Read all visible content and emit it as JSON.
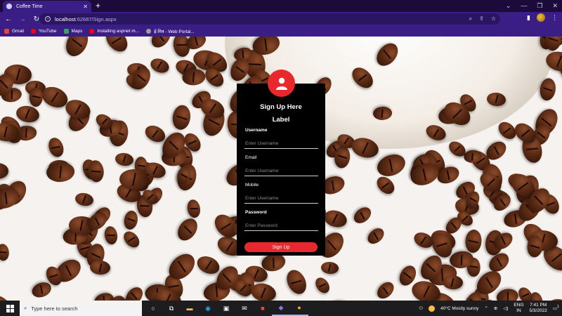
{
  "browser": {
    "tab_title": "Coffee Time",
    "new_tab": "+",
    "url_host": "localhost",
    "url_path": ":62687/Sign.aspx",
    "bookmarks": [
      {
        "label": "Gmail",
        "icon": "gmail-icon",
        "color": "#ea4335"
      },
      {
        "label": "YouTube",
        "icon": "youtube-icon",
        "color": "#ff0000"
      },
      {
        "label": "Maps",
        "icon": "maps-icon",
        "color": "#34a853"
      },
      {
        "label": "Installing aspnet m...",
        "icon": "youtube-icon",
        "color": "#ff0000"
      },
      {
        "label": "ई-मित्र - Web Portal...",
        "icon": "globe-icon",
        "color": "#9e9e9e"
      }
    ]
  },
  "form": {
    "title": "Sign Up Here",
    "label": "Label",
    "fields": [
      {
        "label": "Username",
        "placeholder": "Enter Username"
      },
      {
        "label": "Email",
        "placeholder": "Enter Username"
      },
      {
        "label": "Mobile",
        "placeholder": "Enter Username"
      },
      {
        "label": "Password",
        "placeholder": "Enter Password"
      }
    ],
    "submit_label": "Sign Up",
    "accent_color": "#e8282c"
  },
  "taskbar": {
    "search_placeholder": "Type here to search",
    "weather": "40°C  Mostly sunny",
    "lang_top": "ENG",
    "lang_bottom": "IN",
    "time": "7:41 PM",
    "date": "5/3/2022",
    "notification_count": "1"
  }
}
